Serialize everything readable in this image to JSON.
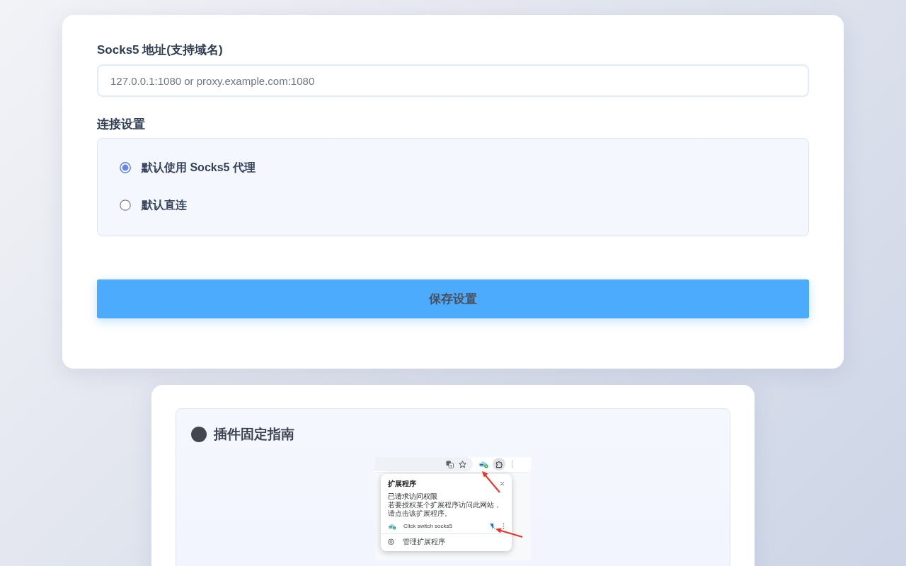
{
  "address": {
    "label": "Socks5 地址(支持域名)",
    "placeholder": "127.0.0.1:1080 or proxy.example.com:1080"
  },
  "connection": {
    "label": "连接设置",
    "options": [
      {
        "label": "默认使用 Socks5 代理",
        "selected": true
      },
      {
        "label": "默认直连",
        "selected": false
      }
    ]
  },
  "save_button": {
    "label": "保存设置"
  },
  "guide": {
    "title": "插件固定指南",
    "screenshot": {
      "popup": {
        "title": "扩展程序",
        "section": "已请求访问权限",
        "description": "若要授权某个扩展程序访问此网站，请点击该扩展程序。",
        "extensions": [
          {
            "name": "Click switch socks5",
            "pinned": true
          }
        ],
        "manage": "管理扩展程序"
      }
    }
  }
}
